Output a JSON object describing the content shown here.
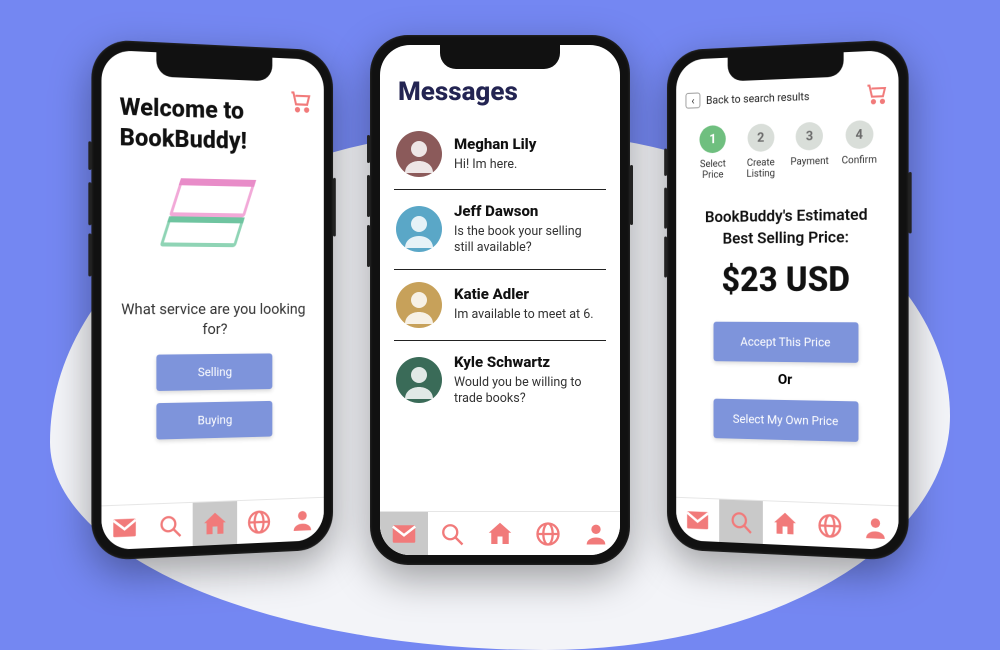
{
  "colors": {
    "accent": "#7e94db",
    "icon": "#f17a7a",
    "stepActive": "#6fbf7f"
  },
  "nav": {
    "icons": [
      "mail",
      "search",
      "home",
      "globe",
      "person"
    ]
  },
  "phone1": {
    "title_line1": "Welcome to",
    "title_line2": "BookBuddy!",
    "prompt": "What service are you looking for?",
    "selling_label": "Selling",
    "buying_label": "Buying",
    "nav_active_index": 2
  },
  "phone2": {
    "title": "Messages",
    "threads": [
      {
        "name": "Meghan Lily",
        "msg": "Hi! Im here.",
        "avatar_bg": "#8b5a5a"
      },
      {
        "name": "Jeff Dawson",
        "msg": "Is the book your selling still available?",
        "avatar_bg": "#5aa7c7"
      },
      {
        "name": "Katie Adler",
        "msg": "Im available to meet at 6.",
        "avatar_bg": "#c7a15a"
      },
      {
        "name": "Kyle Schwartz",
        "msg": "Would you be willing to trade books?",
        "avatar_bg": "#3a6b58"
      }
    ],
    "nav_active_index": 0
  },
  "phone3": {
    "back_label": "Back to search results",
    "steps": [
      {
        "num": "1",
        "label": "Select Price",
        "active": true
      },
      {
        "num": "2",
        "label": "Create Listing",
        "active": false
      },
      {
        "num": "3",
        "label": "Payment",
        "active": false
      },
      {
        "num": "4",
        "label": "Confirm",
        "active": false
      }
    ],
    "headline": "BookBuddy's Estimated Best Selling Price:",
    "price": "$23 USD",
    "accept_label": "Accept This Price",
    "or_label": "Or",
    "own_label": "Select My Own Price",
    "nav_active_index": 1
  }
}
